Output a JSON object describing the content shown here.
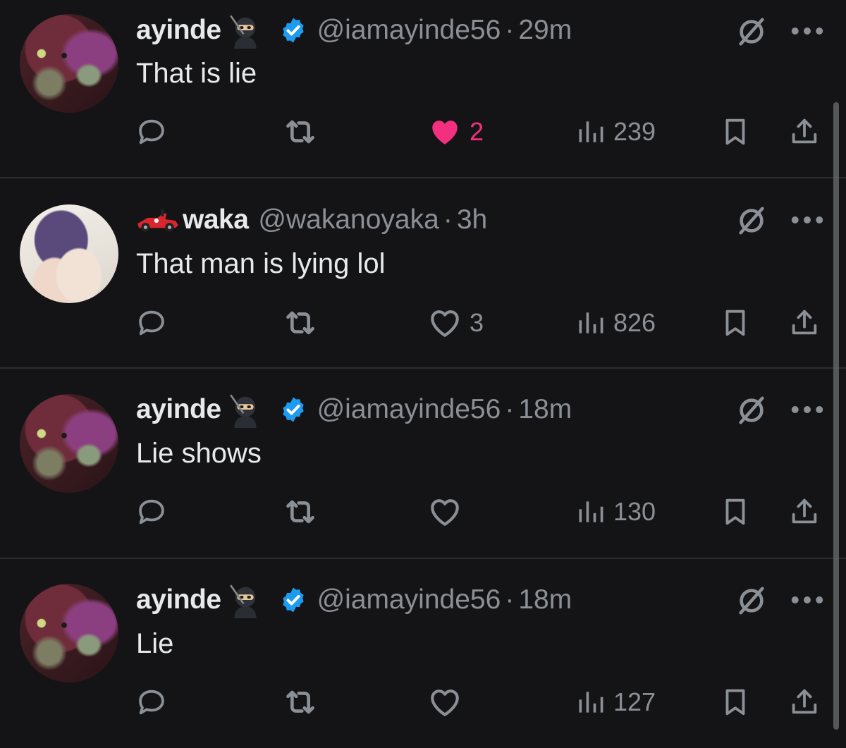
{
  "colors": {
    "background": "#141416",
    "text": "#e7e9ea",
    "muted": "#8b8f96",
    "like": "#f2307f",
    "verified": "#1d9bf0"
  },
  "replies": [
    {
      "name": "ayinde",
      "name_suffix_emoji": "ninja",
      "verified": true,
      "handle": "@iamayinde56",
      "dot": "·",
      "time": "29m",
      "text": "That is lie",
      "likes": "2",
      "liked": true,
      "views": "239"
    },
    {
      "name": "waka",
      "name_prefix_emoji": "racing-car",
      "verified": false,
      "handle": "@wakanoyaka",
      "dot": "·",
      "time": "3h",
      "text": "That man is lying lol",
      "likes": "3",
      "liked": false,
      "views": "826"
    },
    {
      "name": "ayinde",
      "name_suffix_emoji": "ninja",
      "verified": true,
      "handle": "@iamayinde56",
      "dot": "·",
      "time": "18m",
      "text": "Lie shows",
      "likes": "",
      "liked": false,
      "views": "130"
    },
    {
      "name": "ayinde",
      "name_suffix_emoji": "ninja",
      "verified": true,
      "handle": "@iamayinde56",
      "dot": "·",
      "time": "18m",
      "text": "Lie",
      "likes": "",
      "liked": false,
      "views": "127"
    }
  ],
  "icons": {
    "reply": "reply-icon",
    "retweet": "retweet-icon",
    "like": "heart-icon",
    "views": "views-icon",
    "bookmark": "bookmark-icon",
    "share": "share-icon",
    "grok": "grok-icon",
    "more": "more-icon"
  }
}
